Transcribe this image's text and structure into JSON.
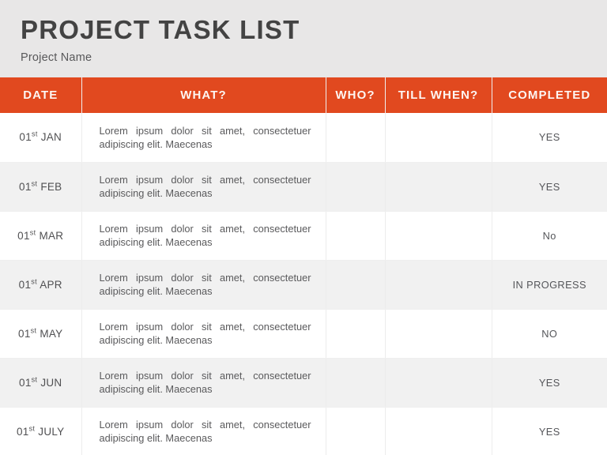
{
  "header": {
    "title": "PROJECT TASK LIST",
    "subtitle": "Project Name"
  },
  "theme": {
    "accent": "#e1491f",
    "page_background": "#e8e7e7",
    "row_odd": "#ffffff",
    "row_even": "#f1f1f1",
    "title_color": "#434343",
    "text_color": "#58585a",
    "header_text_color": "#fdf6f3"
  },
  "table": {
    "columns": [
      {
        "key": "date",
        "label": "DATE"
      },
      {
        "key": "what",
        "label": "WHAT?"
      },
      {
        "key": "who",
        "label": "WHO?"
      },
      {
        "key": "till_when",
        "label": "TILL WHEN?"
      },
      {
        "key": "completed",
        "label": "COMPLETED"
      }
    ],
    "rows": [
      {
        "date_day": "01",
        "date_suffix": "st",
        "date_month": "JAN",
        "what": "Lorem ipsum dolor sit amet, consectetuer adipiscing elit. Maecenas",
        "who": "",
        "till_when": "",
        "completed": "YES"
      },
      {
        "date_day": "01",
        "date_suffix": "st",
        "date_month": "FEB",
        "what": "Lorem ipsum dolor sit amet, consectetuer adipiscing elit. Maecenas",
        "who": "",
        "till_when": "",
        "completed": "YES"
      },
      {
        "date_day": "01",
        "date_suffix": "st",
        "date_month": "MAR",
        "what": "Lorem ipsum dolor sit amet, consectetuer adipiscing elit. Maecenas",
        "who": "",
        "till_when": "",
        "completed": "No"
      },
      {
        "date_day": "01",
        "date_suffix": "st",
        "date_month": "APR",
        "what": "Lorem ipsum dolor sit amet, consectetuer adipiscing elit. Maecenas",
        "who": "",
        "till_when": "",
        "completed": "IN PROGRESS"
      },
      {
        "date_day": "01",
        "date_suffix": "st",
        "date_month": "MAY",
        "what": "Lorem ipsum dolor sit amet, consectetuer adipiscing elit. Maecenas",
        "who": "",
        "till_when": "",
        "completed": "NO"
      },
      {
        "date_day": "01",
        "date_suffix": "st",
        "date_month": "JUN",
        "what": "Lorem ipsum dolor sit amet, consectetuer adipiscing elit. Maecenas",
        "who": "",
        "till_when": "",
        "completed": "YES"
      },
      {
        "date_day": "01",
        "date_suffix": "st",
        "date_month": "JULY",
        "what": "Lorem ipsum dolor sit amet, consectetuer adipiscing elit. Maecenas",
        "who": "",
        "till_when": "",
        "completed": "YES"
      }
    ]
  }
}
